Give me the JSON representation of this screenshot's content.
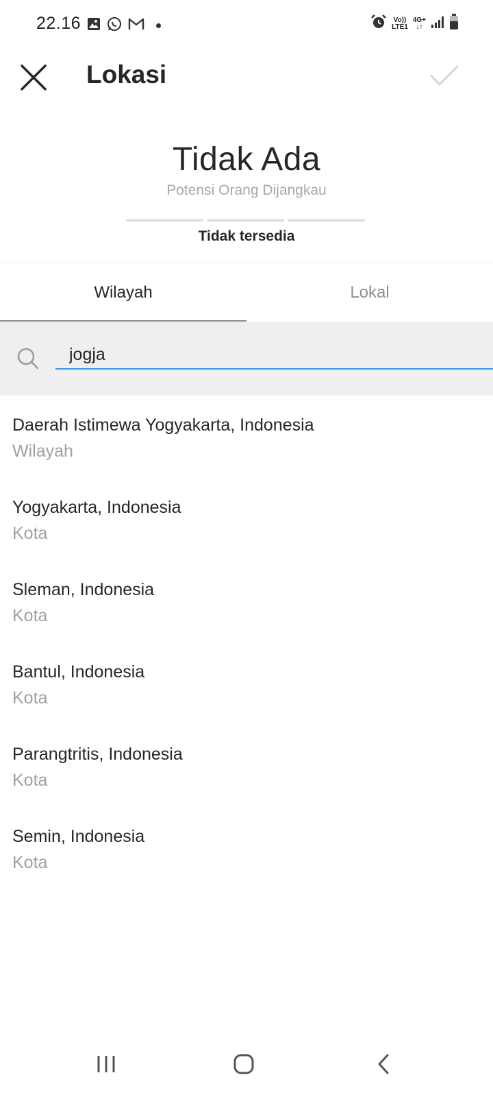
{
  "status_bar": {
    "time": "22.16",
    "left_icons": [
      "gallery-icon",
      "whatsapp-icon",
      "gmail-icon",
      "dot-icon"
    ],
    "network_volte": "Vo))",
    "network_lte": "LTE1",
    "network_type": "4G+",
    "right_icons": [
      "alarm-icon",
      "signal-icon",
      "battery-icon"
    ]
  },
  "header": {
    "title": "Lokasi",
    "close_icon": "close-icon",
    "confirm_icon": "check-icon"
  },
  "reach": {
    "value": "Tidak Ada",
    "label": "Potensi Orang Dijangkau",
    "status": "Tidak tersedia"
  },
  "tabs": [
    {
      "label": "Wilayah",
      "active": true
    },
    {
      "label": "Lokal",
      "active": false
    }
  ],
  "search": {
    "value": "jogja",
    "icon": "search-icon"
  },
  "results": [
    {
      "name": "Daerah Istimewa Yogyakarta, Indonesia",
      "type": "Wilayah"
    },
    {
      "name": "Yogyakarta, Indonesia",
      "type": "Kota"
    },
    {
      "name": "Sleman, Indonesia",
      "type": "Kota"
    },
    {
      "name": "Bantul, Indonesia",
      "type": "Kota"
    },
    {
      "name": "Parangtritis, Indonesia",
      "type": "Kota"
    },
    {
      "name": "Semin, Indonesia",
      "type": "Kota"
    }
  ],
  "nav_bar": [
    "recent-apps-icon",
    "home-icon",
    "back-icon"
  ],
  "colors": {
    "accent": "#3897f0",
    "text": "#262626",
    "muted": "#8e8e8e",
    "search_bg": "#efefef"
  }
}
